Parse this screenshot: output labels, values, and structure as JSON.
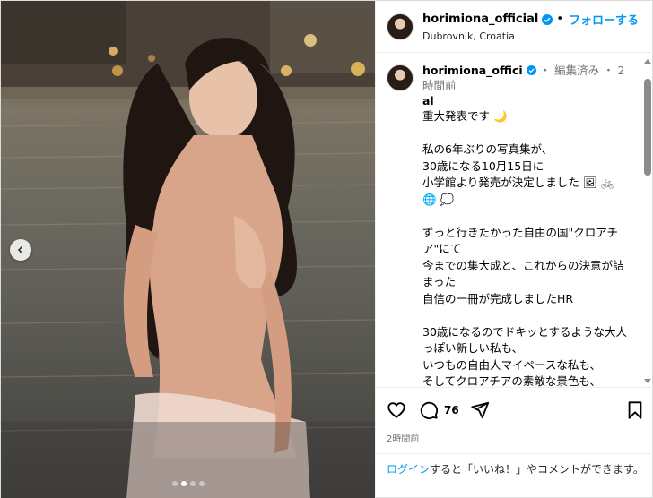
{
  "post": {
    "username": "horimiona_official",
    "follow_label": "フォローする",
    "location": "Dubrovnik, Croatia",
    "caption": {
      "username_line1": "horimiona_offici",
      "username_line2": "al",
      "edited_label": "・ 編集済み",
      "time_ago": "・ 2時間前",
      "body": "重大発表です 🌙\n\n私の6年ぶりの写真集が、\n30歳になる10月15日に\n小学館より発売が決定しました 🖼 🚲\n🌐 💭\n\nずっと行きたかった自由の国\"クロアチア\"にて\n今までの集大成と、これからの決意が詰まった\n自信の一冊が完成しましたHR\n\n30歳になるのでドキッとするような大人っぽい新しい私も、\nいつもの自由人マイペースな私も、\nそしてクロアチアの素敵な景色も、\n是非お手に取って楽しんでいただきたいです😊"
    },
    "comment_count": "76",
    "timestamp": "2時間前",
    "login_link": "ログイン",
    "login_text": "すると「いいね！」やコメントができます。",
    "carousel_dots": 4,
    "carousel_active": 1
  },
  "colors": {
    "accent": "#0095f6",
    "verified": "#0095f6",
    "muted": "#737373"
  },
  "icons": [
    "chevron-left-icon",
    "verified-icon",
    "heart-icon",
    "comment-icon",
    "share-icon",
    "bookmark-icon"
  ]
}
